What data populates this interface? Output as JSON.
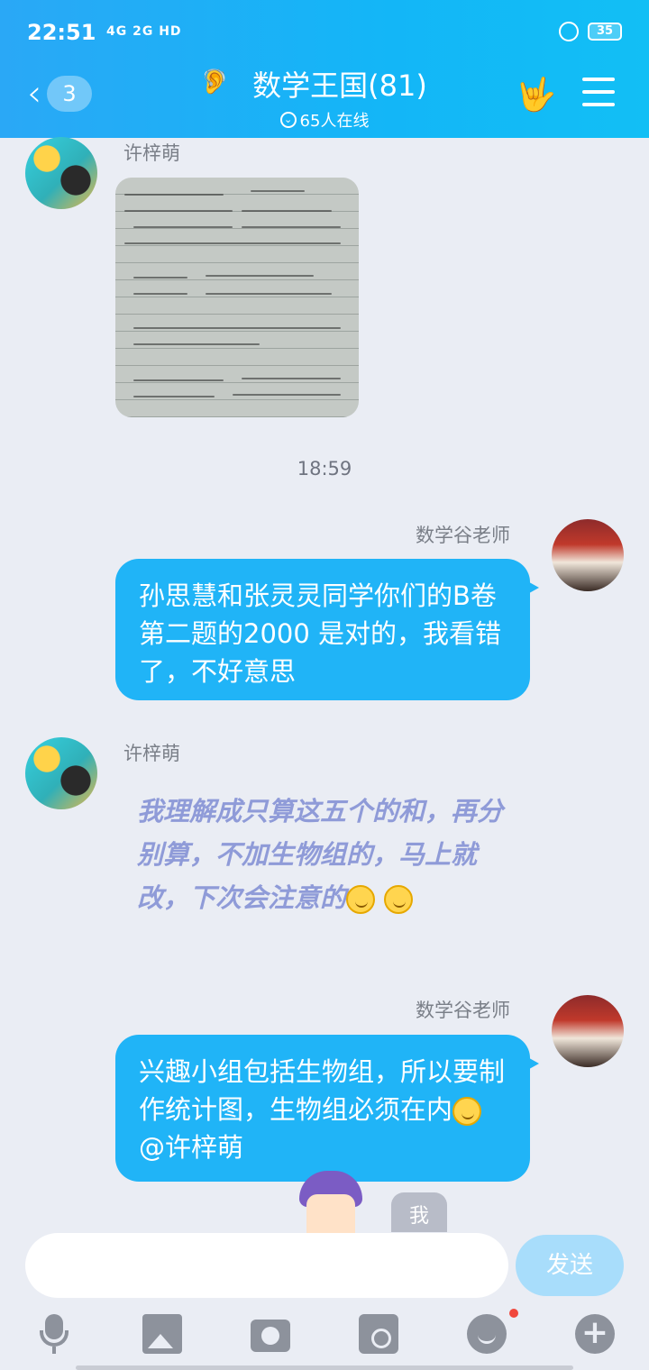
{
  "status_bar": {
    "time": "22:51",
    "network": "4G 2G HD",
    "battery": "35"
  },
  "header": {
    "unread_count": "3",
    "group_title": "数学王国(81)",
    "online_text": "65人在线",
    "colors": {
      "bar": "#20b4f7",
      "bubble": "#20b4f7"
    }
  },
  "messages": [
    {
      "sender": "许梓萌",
      "type": "image",
      "icon": "handwritten-notes-photo"
    },
    {
      "type": "timestamp",
      "text": "18:59"
    },
    {
      "sender": "数学谷老师",
      "type": "text",
      "direction": "out",
      "text": "孙思慧和张灵灵同学你们的B卷第二题的2000 是对的，我看错了，不好意思"
    },
    {
      "sender": "许梓萌",
      "type": "fancy_text",
      "direction": "in",
      "text": "我理解成只算这五个的和，再分别算，不加生物组的，马上就改，下次会注意的"
    },
    {
      "sender": "数学谷老师",
      "type": "text",
      "direction": "out",
      "text": "兴趣小组包括生物组，所以要制作统计图，生物组必须在内",
      "mention": "@许梓萌"
    }
  ],
  "input": {
    "placeholder": "",
    "send_label": "发送",
    "me_label": "我"
  },
  "toolbar": {
    "icons": [
      "mic-icon",
      "image-icon",
      "camera-icon",
      "red-packet-icon",
      "emoji-icon",
      "plus-icon"
    ]
  }
}
